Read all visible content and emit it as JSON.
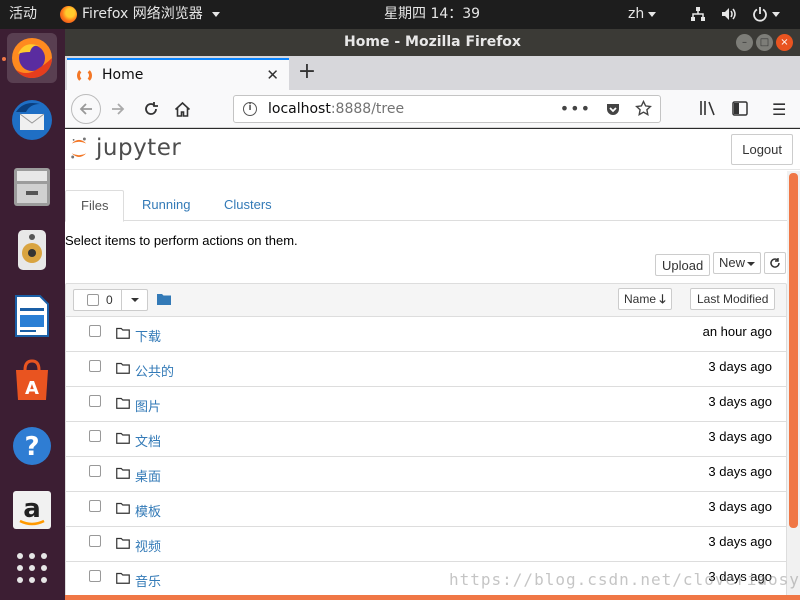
{
  "topbar": {
    "activities": "活动",
    "app_menu": "Firefox 网络浏览器",
    "clock": "星期四 14：39",
    "lang": "zh"
  },
  "dock": {
    "items": [
      "firefox",
      "thunderbird",
      "files",
      "rhythmbox",
      "libreoffice-writer",
      "software-center",
      "help",
      "amazon",
      "show-apps"
    ]
  },
  "window": {
    "title": "Home - Mozilla Firefox"
  },
  "browser": {
    "tab_title": "Home",
    "url_host": "localhost",
    "url_rest": ":8888/tree"
  },
  "jupyter": {
    "logo_text": "jupyter",
    "logout_label": "Logout",
    "tabs": [
      {
        "label": "Files",
        "active": true
      },
      {
        "label": "Running",
        "active": false
      },
      {
        "label": "Clusters",
        "active": false
      }
    ],
    "hint": "Select items to perform actions on them.",
    "upload_label": "Upload",
    "new_label": "New",
    "selected_count": "0",
    "sort_name_label": "Name",
    "sort_modified_label": "Last Modified",
    "files": [
      {
        "name": "下载",
        "modified": "an hour ago"
      },
      {
        "name": "公共的",
        "modified": "3 days ago"
      },
      {
        "name": "图片",
        "modified": "3 days ago"
      },
      {
        "name": "文档",
        "modified": "3 days ago"
      },
      {
        "name": "桌面",
        "modified": "3 days ago"
      },
      {
        "name": "模板",
        "modified": "3 days ago"
      },
      {
        "name": "视频",
        "modified": "3 days ago"
      },
      {
        "name": "音乐",
        "modified": "3 days ago"
      }
    ]
  },
  "watermark": "https://blog.csdn.net/cloveriaosy",
  "colors": {
    "accent": "#f07746",
    "link": "#337ab7",
    "dock_bg": "#3c1e33"
  }
}
